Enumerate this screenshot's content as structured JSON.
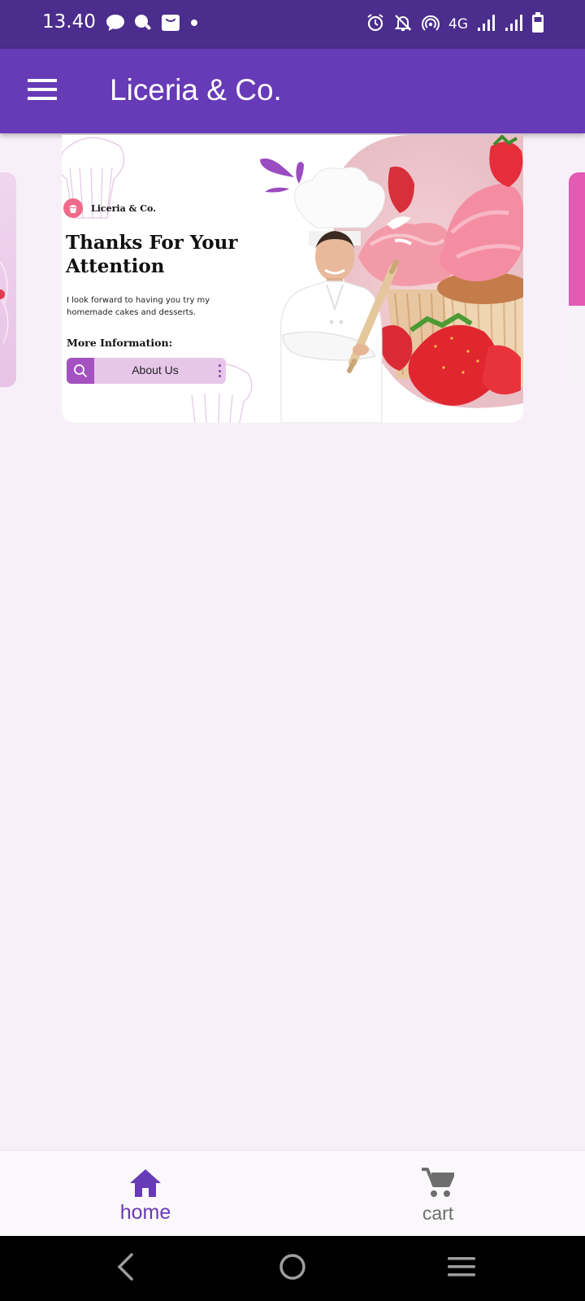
{
  "status_bar": {
    "time": "13.40",
    "network": "4G",
    "left_icons": [
      "chat-bubble-icon",
      "chat-search-icon",
      "shopping-bag-icon",
      "dot-icon"
    ],
    "right_icons": [
      "alarm-icon",
      "bell-off-icon",
      "hotspot-icon",
      "signal-icon",
      "signal-icon",
      "battery-icon"
    ]
  },
  "app_bar": {
    "title": "Liceria & Co.",
    "menu_icon": "hamburger-menu-icon"
  },
  "carousel": {
    "current_slide": {
      "brand": "Liceria & Co.",
      "headline_line1": "Thanks For Your",
      "headline_line2": "Attention",
      "body_line1": "I look forward to having you try my",
      "body_line2": "homemade cakes and desserts.",
      "more_info": "More Information:",
      "about_button": "About Us"
    }
  },
  "bottom_nav": {
    "items": [
      {
        "label": "home",
        "icon": "home-icon",
        "selected": true
      },
      {
        "label": "cart",
        "icon": "cart-icon",
        "selected": false
      }
    ]
  },
  "colors": {
    "status_bar": "#4a2d8c",
    "app_bar": "#673ab7",
    "background": "#f8f0f8",
    "accent": "#673ab7"
  }
}
